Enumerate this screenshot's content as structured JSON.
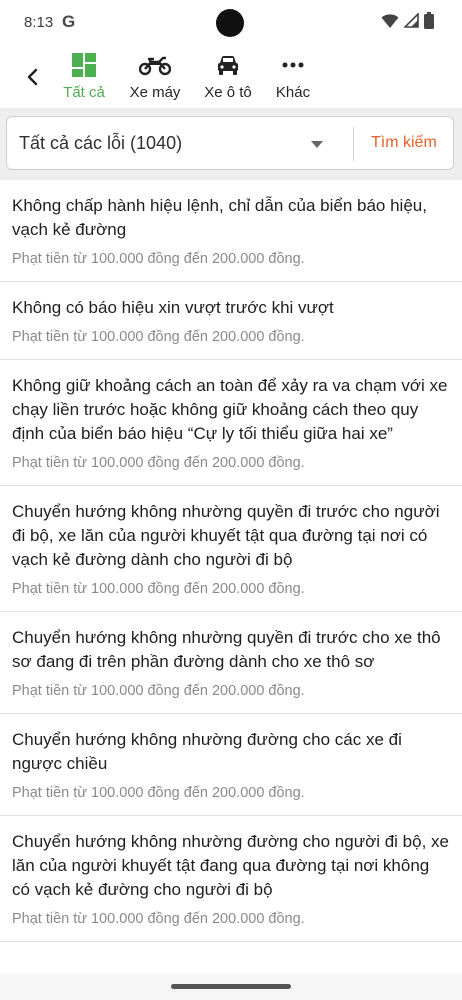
{
  "status": {
    "time": "8:13",
    "g_logo": "G"
  },
  "nav": {
    "tabs": [
      {
        "label": "Tất cả",
        "icon": "grid-icon",
        "active": true
      },
      {
        "label": "Xe máy",
        "icon": "motorbike-icon",
        "active": false
      },
      {
        "label": "Xe ô tô",
        "icon": "car-icon",
        "active": false
      },
      {
        "label": "Khác",
        "icon": "more-icon",
        "active": false
      }
    ]
  },
  "filter": {
    "selected": "Tất cả các lỗi (1040)",
    "search_label": "Tìm kiếm"
  },
  "items": [
    {
      "title": "Không chấp hành hiệu lệnh, chỉ dẫn của biển báo hiệu, vạch kẻ đường",
      "fine": "Phạt tiền từ 100.000 đồng đến 200.000 đồng."
    },
    {
      "title": "Không có báo hiệu xin vượt trước khi vượt",
      "fine": "Phạt tiền từ 100.000 đồng đến 200.000 đồng."
    },
    {
      "title": "Không giữ khoảng cách an toàn để xảy ra va chạm với xe chạy liền trước hoặc không giữ khoảng cách theo quy định của biển báo hiệu “Cự ly tối thiểu giữa hai xe”",
      "fine": "Phạt tiền từ 100.000 đồng đến 200.000 đồng."
    },
    {
      "title": "Chuyển hướng không nhường quyền đi trước cho người đi bộ, xe lăn của người khuyết tật qua đường tại nơi có vạch kẻ đường dành cho người đi bộ",
      "fine": "Phạt tiền từ 100.000 đồng đến 200.000 đồng."
    },
    {
      "title": "Chuyển hướng không nhường quyền đi trước cho xe thô sơ đang đi trên phần đường dành cho xe thô sơ",
      "fine": "Phạt tiền từ 100.000 đồng đến 200.000 đồng."
    },
    {
      "title": "Chuyển hướng không nhường đường cho các xe đi ngược chiều",
      "fine": "Phạt tiền từ 100.000 đồng đến 200.000 đồng."
    },
    {
      "title": "Chuyển hướng không nhường đường cho người đi bộ, xe lăn của người khuyết tật đang qua đường tại nơi không có vạch kẻ đường cho người đi bộ",
      "fine": "Phạt tiền từ 100.000 đồng đến 200.000 đồng."
    }
  ],
  "colors": {
    "accent_green": "#4caf50",
    "search_orange": "#e8612c"
  }
}
